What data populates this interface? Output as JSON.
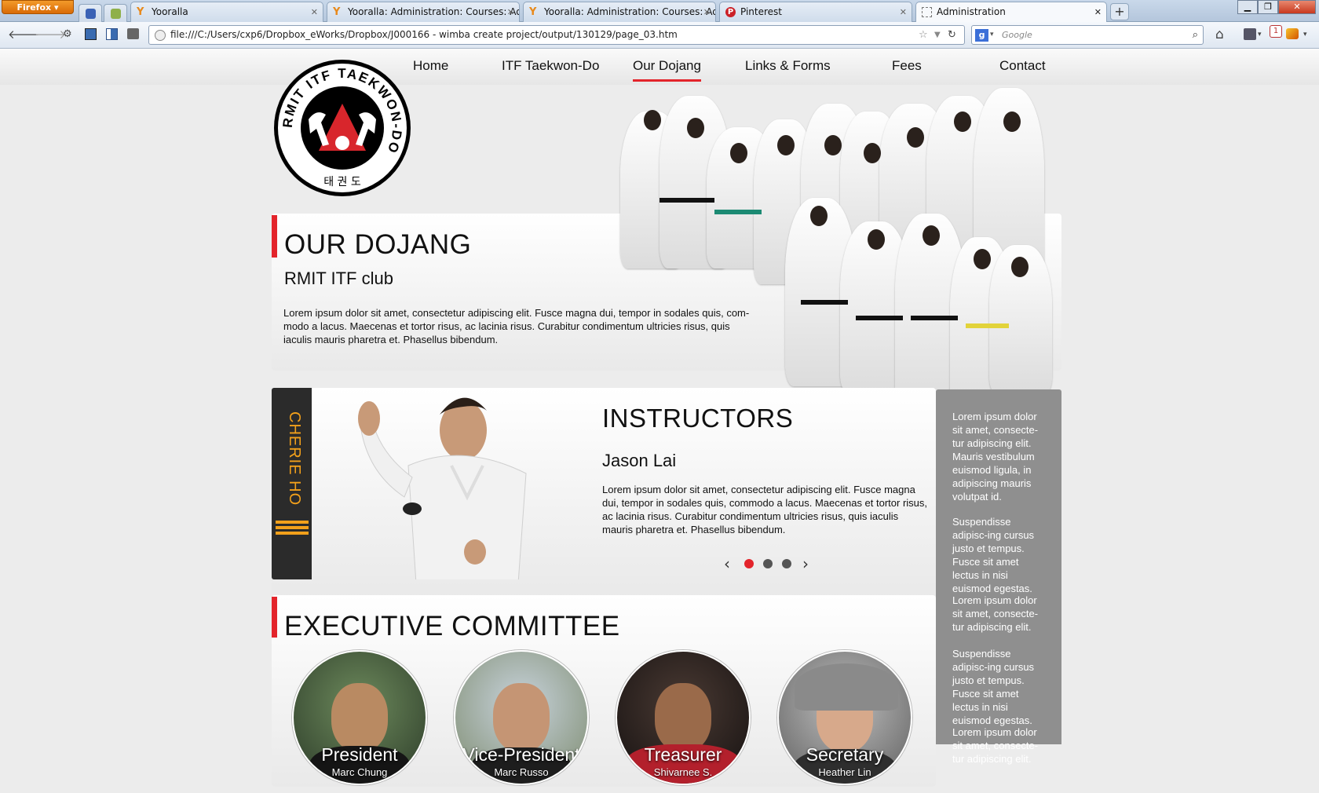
{
  "browser": {
    "menu_button": "Firefox",
    "tabs": [
      {
        "title": "Yooralla",
        "favicon": "yooralla-icon"
      },
      {
        "title": "Yooralla: Administration: Courses: Ad...",
        "favicon": "yooralla-icon"
      },
      {
        "title": "Yooralla: Administration: Courses: Ad...",
        "favicon": "yooralla-icon"
      },
      {
        "title": "Pinterest",
        "favicon": "pinterest-icon"
      },
      {
        "title": "Administration",
        "favicon": "blank-page-icon"
      }
    ],
    "url": "file:///C:/Users/cxp6/Dropbox_eWorks/Dropbox/J000166 - wimba create project/output/130129/page_03.htm",
    "search_placeholder": "Google",
    "notification_badge": "1"
  },
  "site": {
    "nav": [
      "Home",
      "ITF Taekwon-Do",
      "Our Dojang",
      "Links & Forms",
      "Fees",
      "Contact"
    ],
    "active_nav": "Our Dojang",
    "accent_color": "#e3242b",
    "logo": {
      "ring_text": "RMIT ITF TAEKWON-DO",
      "korean": "태 권 도"
    },
    "dojang": {
      "title": "OUR DOJANG",
      "subtitle": "RMIT ITF club",
      "body": "Lorem ipsum dolor sit amet, consectetur adipiscing elit. Fusce magna dui, tempor in sodales quis, com-modo a lacus. Maecenas et tortor risus, ac lacinia risus. Curabitur condimentum ultricies risus, quis iaculis mauris pharetra et. Phasellus bibendum."
    },
    "instructors": {
      "belt_name": "CHERIE HO",
      "title": "INSTRUCTORS",
      "name": "Jason Lai",
      "body": "Lorem ipsum dolor sit amet, consectetur adipiscing elit. Fusce magna dui, tempor in sodales quis, commodo a lacus. Maecenas et tortor risus, ac lacinia risus. Curabitur condimentum ultricies risus, quis iaculis mauris pharetra et. Phasellus bibendum.",
      "slides_total": 3,
      "active_slide": 1
    },
    "sidebar": [
      "Lorem ipsum dolor sit amet, consecte-tur adipiscing elit. Mauris vestibulum euismod ligula, in adipiscing mauris volutpat id.",
      "Suspendisse adipisc-ing cursus justo et tempus. Fusce sit amet lectus in nisi euismod egestas.",
      "Lorem ipsum dolor sit amet, consecte-tur adipiscing elit.",
      "Suspendisse adipisc-ing cursus justo et tempus. Fusce sit amet lectus in nisi euismod egestas.",
      "Lorem ipsum dolor sit amet, consecte-tur adipiscing elit."
    ],
    "committee": {
      "title": "EXECUTIVE COMMITTEE",
      "members": [
        {
          "role": "President",
          "name": "Marc Chung"
        },
        {
          "role": "Vice-President",
          "name": "Marc Russo"
        },
        {
          "role": "Treasurer",
          "name": "Shivarnee S."
        },
        {
          "role": "Secretary",
          "name": "Heather Lin"
        }
      ]
    }
  }
}
